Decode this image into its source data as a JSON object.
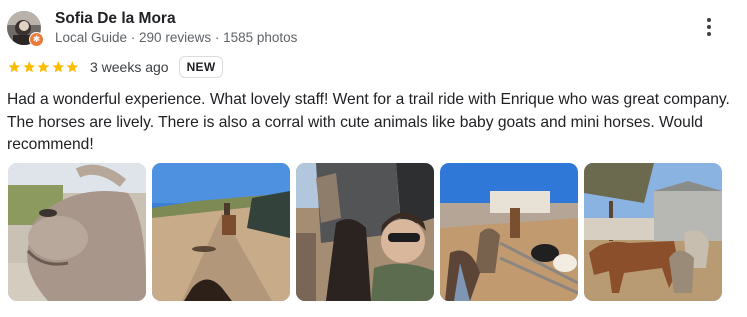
{
  "reviewer": {
    "name": "Sofia De la Mora",
    "meta": "Local Guide · 290 reviews · 1585 photos"
  },
  "rating": {
    "stars": 5,
    "max": 5,
    "color": "#fbbc04"
  },
  "time_ago": "3 weeks ago",
  "badge": "NEW",
  "review_text": "Had a wonderful experience. What lovely staff! Went for a trail ride with Enrique who was great company. The horses are lively. There is also a corral with cute animals like baby goats and mini horses. Would recommend!",
  "photos": [
    "pony-closeup",
    "trail-ride",
    "selfie-with-horse",
    "corral-goats",
    "barn-mini-horses"
  ],
  "icons": {
    "more": "more-vert-icon",
    "local_guide": "local-guide-badge-icon",
    "star": "star-icon"
  }
}
